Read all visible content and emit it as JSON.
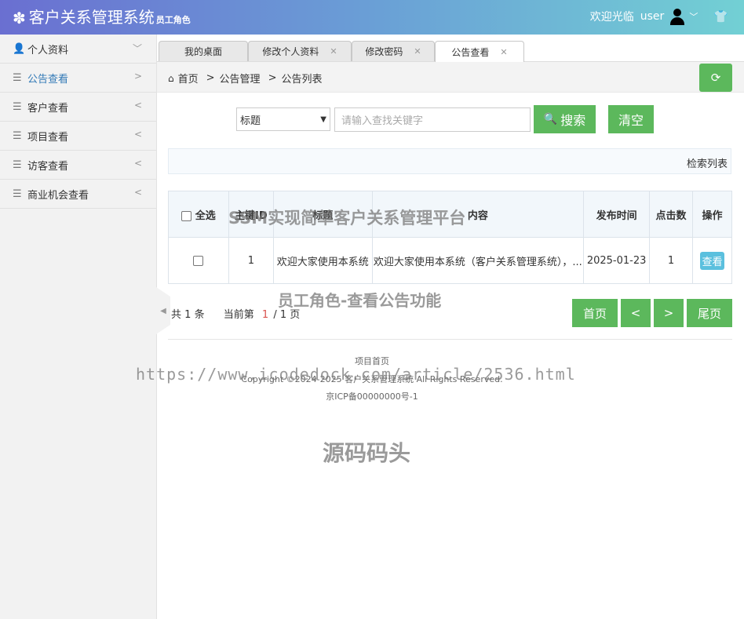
{
  "header": {
    "title": "客户关系管理系统",
    "role_label": "员工角色",
    "welcome": "欢迎光临",
    "username": "user"
  },
  "sidebar": {
    "items": [
      {
        "label": "个人资料",
        "icon": "user-icon",
        "arrow": "﹀"
      },
      {
        "label": "公告查看",
        "icon": "list-icon",
        "arrow": ">"
      },
      {
        "label": "客户查看",
        "icon": "list-icon",
        "arrow": "<"
      },
      {
        "label": "项目查看",
        "icon": "list-icon",
        "arrow": "<"
      },
      {
        "label": "访客查看",
        "icon": "list-icon",
        "arrow": "<"
      },
      {
        "label": "商业机会查看",
        "icon": "list-icon",
        "arrow": "<"
      }
    ]
  },
  "tabs": [
    {
      "label": "我的桌面"
    },
    {
      "label": "修改个人资料"
    },
    {
      "label": "修改密码"
    },
    {
      "label": "公告查看"
    }
  ],
  "breadcrumb": [
    "首页",
    "公告管理",
    "公告列表"
  ],
  "search": {
    "field_selected": "标题",
    "placeholder": "请输入查找关键字",
    "search_label": "搜索",
    "clear_label": "清空"
  },
  "info_bar": "检索列表",
  "table": {
    "select_all": "全选",
    "headers": [
      "主键ID",
      "标题",
      "内容",
      "发布时间",
      "点击数",
      "操作"
    ],
    "rows": [
      {
        "id": "1",
        "title": "欢迎大家使用本系统",
        "content": "欢迎大家使用本系统（客户关系管理系统），...",
        "date": "2025-01-23",
        "clicks": "1",
        "action": "查看"
      }
    ]
  },
  "pager": {
    "total_prefix": "共",
    "total": "1",
    "total_suffix": "条",
    "current_prefix": "当前第",
    "current": "1",
    "of": "/ 1 页",
    "first": "首页",
    "prev": "<",
    "next": ">",
    "last": "尾页"
  },
  "footer": {
    "line1": "项目首页",
    "line2": "Copyright ©2024-2025 客户关系管理系统 All Rights Reserved.",
    "line3": "京ICP备00000000号-1"
  },
  "watermarks": {
    "w1": "SSM实现简单客户关系管理平台",
    "w2": "员工角色-查看公告功能",
    "w3": "https://www.icodedock.com/article/2536.html",
    "w4": "源码码头"
  },
  "colors": {
    "primary_green": "#5cb85c",
    "info_blue": "#5bc0de",
    "header_gradient_start": "#6a6fd1",
    "header_gradient_end": "#72d0d4",
    "active_link": "#337ab7"
  }
}
